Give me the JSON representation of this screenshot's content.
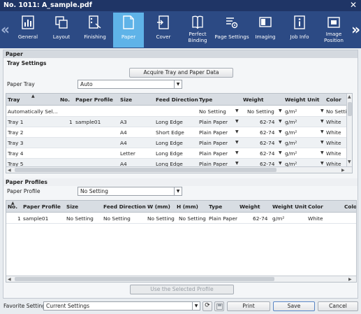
{
  "window": {
    "title": "No. 1011: A_sample.pdf"
  },
  "nav": {
    "tabs": [
      {
        "label": "General",
        "icon": "general-icon"
      },
      {
        "label": "Layout",
        "icon": "layout-icon"
      },
      {
        "label": "Finishing",
        "icon": "finishing-icon"
      },
      {
        "label": "Paper",
        "icon": "paper-icon",
        "active": true
      },
      {
        "label": "Cover",
        "icon": "cover-icon"
      },
      {
        "label": "Perfect Binding",
        "icon": "perfect-binding-icon"
      },
      {
        "label": "Page Settings",
        "icon": "page-settings-icon"
      },
      {
        "label": "Imaging",
        "icon": "imaging-icon"
      },
      {
        "label": "Job Info",
        "icon": "job-info-icon"
      },
      {
        "label": "Image Position",
        "icon": "image-position-icon"
      }
    ]
  },
  "paper": {
    "section_title": "Paper",
    "tray_settings": {
      "title": "Tray Settings",
      "acquire_button": "Acquire Tray and Paper Data",
      "paper_tray_label": "Paper Tray",
      "paper_tray_value": "Auto",
      "columns": [
        "Tray",
        "No.",
        "Paper Profile",
        "Size",
        "Feed Direction",
        "Type",
        "Weight",
        "Weight Unit",
        "Color"
      ],
      "rows": [
        {
          "tray": "Automatically Sel...",
          "no": "",
          "profile": "",
          "size": "",
          "feed": "",
          "type": "No Setting",
          "weight": "No Setting",
          "unit": "g/m²",
          "color": "No Setting"
        },
        {
          "tray": "Tray 1",
          "no": "1",
          "profile": "sample01",
          "size": "A3",
          "feed": "Long Edge",
          "type": "Plain Paper",
          "weight": "62-74",
          "unit": "g/m²",
          "color": "White"
        },
        {
          "tray": "Tray 2",
          "no": "",
          "profile": "",
          "size": "A4",
          "feed": "Short Edge",
          "type": "Plain Paper",
          "weight": "62-74",
          "unit": "g/m²",
          "color": "White"
        },
        {
          "tray": "Tray 3",
          "no": "",
          "profile": "",
          "size": "A4",
          "feed": "Long Edge",
          "type": "Plain Paper",
          "weight": "62-74",
          "unit": "g/m²",
          "color": "White"
        },
        {
          "tray": "Tray 4",
          "no": "",
          "profile": "",
          "size": "Letter",
          "feed": "Long Edge",
          "type": "Plain Paper",
          "weight": "62-74",
          "unit": "g/m²",
          "color": "White"
        },
        {
          "tray": "Tray 5",
          "no": "",
          "profile": "",
          "size": "A4",
          "feed": "Long Edge",
          "type": "Plain Paper",
          "weight": "62-74",
          "unit": "g/m²",
          "color": "White"
        }
      ]
    },
    "profiles": {
      "title": "Paper Profiles",
      "profile_label": "Paper Profile",
      "profile_value": "No Setting",
      "columns": [
        "No.",
        "Paper Profile",
        "Size",
        "Feed Direction",
        "W (mm)",
        "H (mm)",
        "Type",
        "Weight",
        "Weight Unit",
        "Color",
        "Color I"
      ],
      "rows": [
        {
          "no": "1",
          "profile": "sample01",
          "size": "No Setting",
          "feed": "No Setting",
          "w": "No Setting",
          "h": "No Setting",
          "type": "Plain Paper",
          "weight": "62-74",
          "unit": "g/m²",
          "color": "White"
        }
      ],
      "use_button": "Use the Selected Profile"
    }
  },
  "footer": {
    "favorite_label": "Favorite Setting",
    "favorite_value": "Current Settings",
    "print_button": "Print",
    "save_button": "Save",
    "cancel_button": "Cancel"
  },
  "colors": {
    "titlebar": "#1f3566",
    "iconbar": "#2c4a84",
    "active_tab": "#5fb3e8"
  }
}
